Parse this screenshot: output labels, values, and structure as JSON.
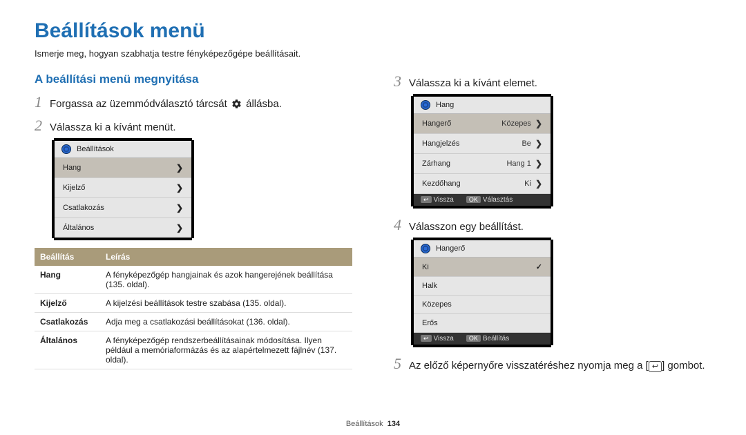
{
  "page": {
    "title": "Beállítások menü",
    "intro": "Ismerje meg, hogyan szabhatja testre fényképezőgépe beállításait.",
    "footer_label": "Beállítások",
    "footer_page": "134"
  },
  "left": {
    "subheading": "A beállítási menü megnyitása",
    "step1_prefix": "Forgassa az üzemmódválasztó tárcsát ",
    "step1_suffix": " állásba.",
    "step2": "Válassza ki a kívánt menüt.",
    "panel_title": "Beállítások",
    "panel_items": [
      "Hang",
      "Kijelző",
      "Csatlakozás",
      "Általános"
    ],
    "table": {
      "head": [
        "Beállítás",
        "Leírás"
      ],
      "rows": [
        [
          "Hang",
          "A fényképezőgép hangjainak és azok hangerejének beállítása (135. oldal)."
        ],
        [
          "Kijelző",
          "A kijelzési beállítások testre szabása (135. oldal)."
        ],
        [
          "Csatlakozás",
          "Adja meg a csatlakozási beállításokat (136. oldal)."
        ],
        [
          "Általános",
          "A fényképezőgép rendszerbeállításainak módosítása. Ilyen például a memóriaformázás és az alapértelmezett fájlnév (137. oldal)."
        ]
      ]
    }
  },
  "right": {
    "step3": "Válassza ki a kívánt elemet.",
    "panel3_title": "Hang",
    "panel3_rows": [
      {
        "label": "Hangerő",
        "value": "Közepes",
        "highlight": true
      },
      {
        "label": "Hangjelzés",
        "value": "Be"
      },
      {
        "label": "Zárhang",
        "value": "Hang 1"
      },
      {
        "label": "Kezdőhang",
        "value": "Ki"
      }
    ],
    "footer3_back": "Vissza",
    "footer3_ok": "Választás",
    "step4": "Válasszon egy beállítást.",
    "panel4_title": "Hangerő",
    "panel4_rows": [
      {
        "label": "Ki",
        "check": true
      },
      {
        "label": "Halk"
      },
      {
        "label": "Közepes"
      },
      {
        "label": "Erős"
      }
    ],
    "footer4_back": "Vissza",
    "footer4_ok": "Beállítás",
    "step5_prefix": "Az előző képernyőre visszatéréshez nyomja meg a [",
    "step5_suffix": "] gombot.",
    "ok_label": "OK"
  }
}
